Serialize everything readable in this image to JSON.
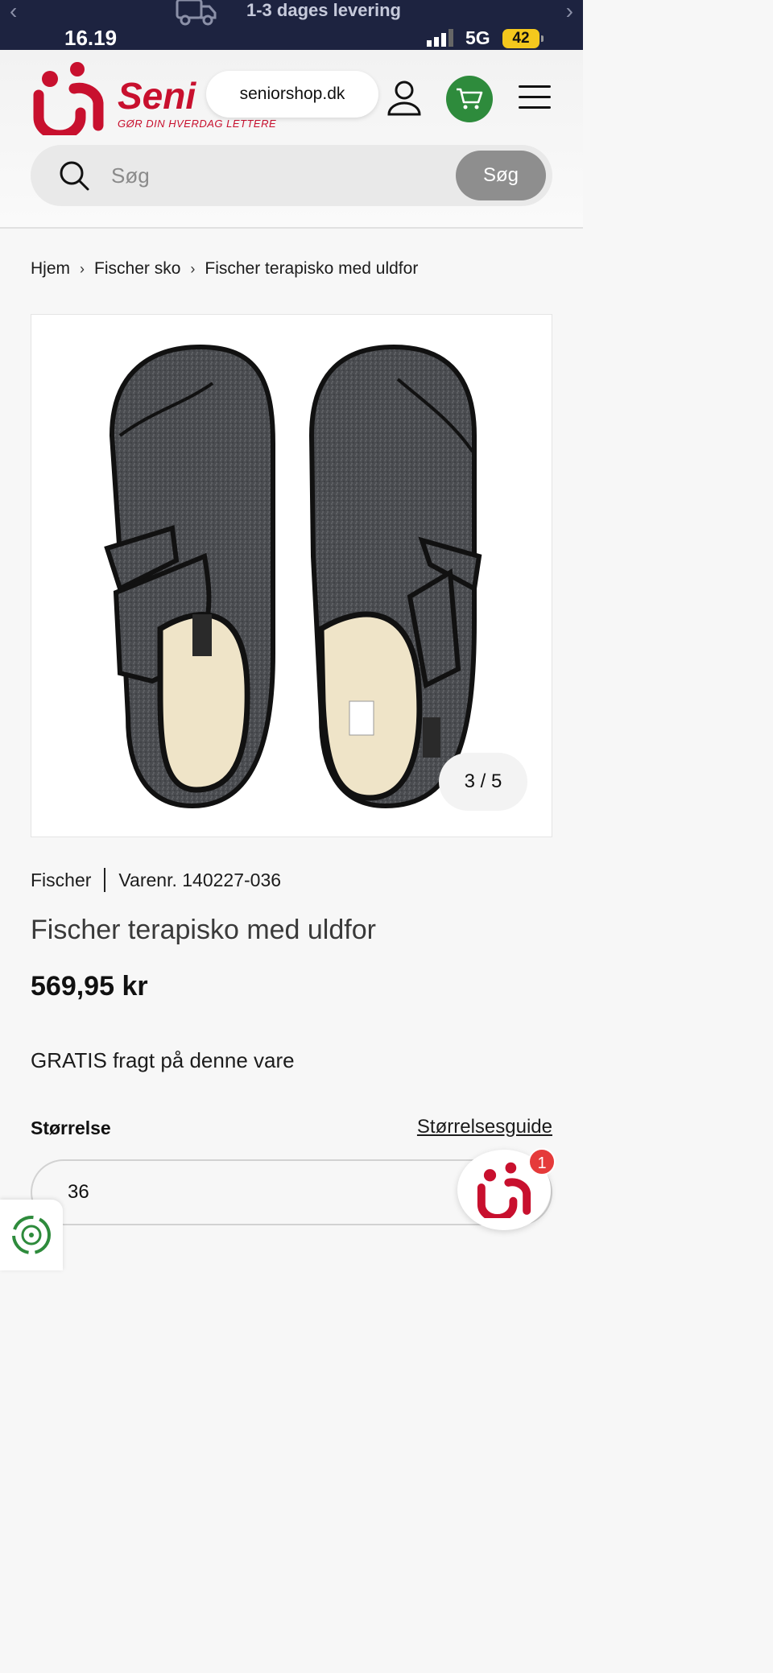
{
  "status_bar": {
    "promo_text": "1-3 dages levering",
    "time": "16.19",
    "network": "5G",
    "battery": "42"
  },
  "header": {
    "brand": "Seni",
    "tagline": "GØR DIN HVERDAG LETTERE",
    "url": "seniorshop.dk",
    "logo_color": "#c8102e",
    "cart_color": "#2e8b3c"
  },
  "search": {
    "placeholder": "Søg",
    "button_label": "Søg"
  },
  "breadcrumb": {
    "items": [
      "Hjem",
      "Fischer sko",
      "Fischer terapisko med uldfor"
    ]
  },
  "product": {
    "image_counter": "3 / 5",
    "brand": "Fischer",
    "sku": "Varenr. 140227-036",
    "title": "Fischer terapisko med uldfor",
    "price": "569,95 kr",
    "shipping": "GRATIS fragt på denne vare",
    "size_label": "Størrelse",
    "size_guide": "Størrelsesguide",
    "selected_size": "36"
  },
  "chat": {
    "badge_count": "1"
  }
}
